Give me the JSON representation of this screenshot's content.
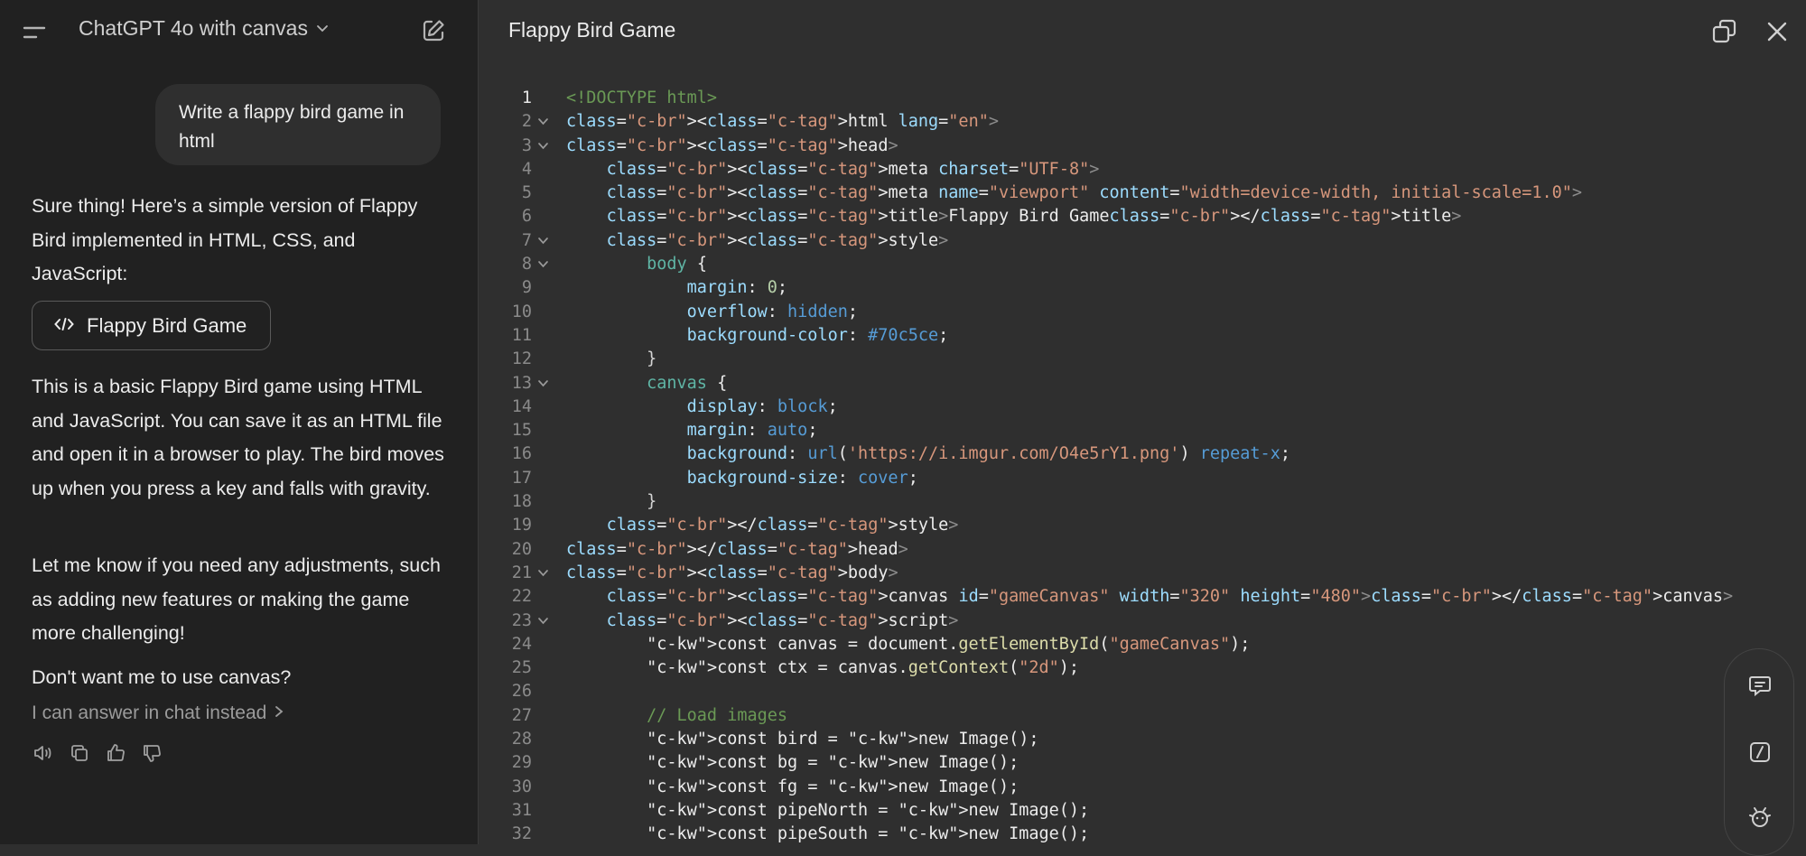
{
  "header": {
    "model_title": "ChatGPT 4o with canvas"
  },
  "chat": {
    "user_message": "Write a flappy bird game in html",
    "intro": "Sure thing! Here’s a simple version of Flappy Bird implemented in HTML, CSS, and JavaScript:",
    "canvas_button_label": "Flappy Bird Game",
    "description": "This is a basic Flappy Bird game using HTML and JavaScript. You can save it as an HTML file and open it in a browser to play. The bird moves up when you press a key and falls with gravity.",
    "followup": "Let me know if you need any adjustments, such as adding new features or making the game more challenging!",
    "canvas_question": "Don't want me to use canvas?",
    "answer_in_chat_link": "I can answer in chat instead"
  },
  "canvas": {
    "title": "Flappy Bird Game",
    "active_line": 1,
    "line_numbers": [
      "1",
      "2",
      "3",
      "4",
      "5",
      "6",
      "7",
      "8",
      "9",
      "10",
      "11",
      "12",
      "13",
      "14",
      "15",
      "16",
      "17",
      "18",
      "19",
      "20",
      "21",
      "22",
      "23",
      "24",
      "25",
      "26",
      "27",
      "28",
      "29",
      "30",
      "31",
      "32"
    ],
    "foldable_lines": [
      2,
      3,
      7,
      8,
      13,
      21,
      23
    ],
    "code": [
      "<!DOCTYPE html>",
      "<html lang=\"en\">",
      "<head>",
      "    <meta charset=\"UTF-8\">",
      "    <meta name=\"viewport\" content=\"width=device-width, initial-scale=1.0\">",
      "    <title>Flappy Bird Game</title>",
      "    <style>",
      "        body {",
      "            margin: 0;",
      "            overflow: hidden;",
      "            background-color: #70c5ce;",
      "        }",
      "        canvas {",
      "            display: block;",
      "            margin: auto;",
      "            background: url('https://i.imgur.com/O4e5rY1.png') repeat-x;",
      "            background-size: cover;",
      "        }",
      "    </style>",
      "</head>",
      "<body>",
      "    <canvas id=\"gameCanvas\" width=\"320\" height=\"480\"></canvas>",
      "    <script>",
      "        const canvas = document.getElementById(\"gameCanvas\");",
      "        const ctx = canvas.getContext(\"2d\");",
      "",
      "        // Load images",
      "        const bird = new Image();",
      "        const bg = new Image();",
      "        const fg = new Image();",
      "        const pipeNorth = new Image();",
      "        const pipeSouth = new Image();"
    ]
  }
}
